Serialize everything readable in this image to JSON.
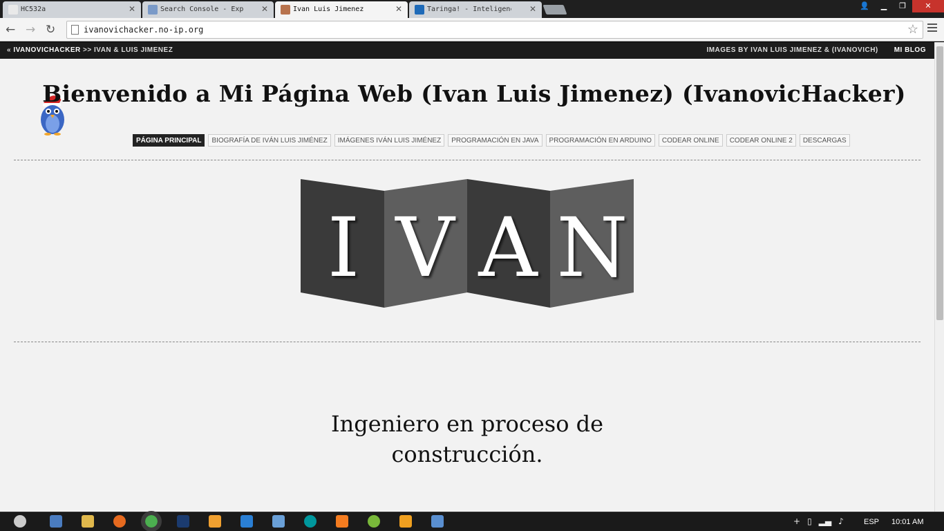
{
  "browser": {
    "tabs": [
      {
        "title": "HC532a",
        "favicon_color": "#e9e9e9",
        "active": false
      },
      {
        "title": "Search Console - Explor",
        "favicon_color": "#7a9ac8",
        "active": false
      },
      {
        "title": "Ivan Luis Jimenez",
        "favicon_color": "#b8734d",
        "active": true
      },
      {
        "title": "Taringa! - Inteligencia",
        "favicon_color": "#1e6ab8",
        "active": false
      }
    ],
    "url": "ivanovichacker.no-ip.org",
    "window_controls": {
      "user": "👤",
      "minimize": "▁",
      "restore": "❐",
      "close": "✕"
    }
  },
  "site": {
    "topbar": {
      "back_arrow": "«",
      "brand": "IVANOVICHACKER",
      "separator": ">>",
      "crumb": "IVAN & LUIS JIMENEZ",
      "images_credit": "IMAGES BY IVAN LUIS JIMENEZ & (IVANOVICH)",
      "blog_link": "MI BLOG"
    },
    "title": "Bienvenido a Mi Página Web (Ivan Luis Jimenez) (IvanovicHacker)",
    "nav": [
      {
        "label": "PÁGINA PRINCIPAL",
        "active": true
      },
      {
        "label": "BIOGRAFÍA DE IVÁN LUIS JIMÉNEZ",
        "active": false
      },
      {
        "label": "IMÁGENES IVÁN LUIS JIMÉNEZ",
        "active": false
      },
      {
        "label": "PROGRAMACIÓN EN JAVA",
        "active": false
      },
      {
        "label": "PROGRAMACIÓN EN ARDUINO",
        "active": false
      },
      {
        "label": "CODEAR ONLINE",
        "active": false
      },
      {
        "label": "CODEAR ONLINE 2",
        "active": false
      },
      {
        "label": "DESCARGAS",
        "active": false
      }
    ],
    "logo_letters": [
      "I",
      "V",
      "A",
      "N"
    ],
    "logo_colors": [
      "#3a3a3a",
      "#5e5e5e",
      "#3a3a3a",
      "#5e5e5e"
    ],
    "tagline_line1": "Ingeniero en proceso de",
    "tagline_line2": "construcción."
  },
  "taskbar": {
    "apps": [
      {
        "name": "start-apple-icon",
        "color": "#cccccc"
      },
      {
        "name": "explorer-window-icon",
        "color": "#4a7cc0"
      },
      {
        "name": "folder-icon",
        "color": "#e0b84c"
      },
      {
        "name": "firefox-icon",
        "color": "#e66a1f"
      },
      {
        "name": "chrome-icon",
        "color": "#4caf50"
      },
      {
        "name": "photoshop-icon",
        "color": "#1b3b6f"
      },
      {
        "name": "fl-studio-icon",
        "color": "#f0a030"
      },
      {
        "name": "window-app-icon",
        "color": "#2a7fd4"
      },
      {
        "name": "virtualbox-icon",
        "color": "#6aa0d8"
      },
      {
        "name": "arduino-icon",
        "color": "#00979d"
      },
      {
        "name": "xampp-icon",
        "color": "#f47c20"
      },
      {
        "name": "utorrent-icon",
        "color": "#79b83a"
      },
      {
        "name": "media-player-icon",
        "color": "#f0a020"
      },
      {
        "name": "screen-app-icon",
        "color": "#5a8fd0"
      }
    ],
    "language": "ESP",
    "time": "10:01 AM"
  }
}
